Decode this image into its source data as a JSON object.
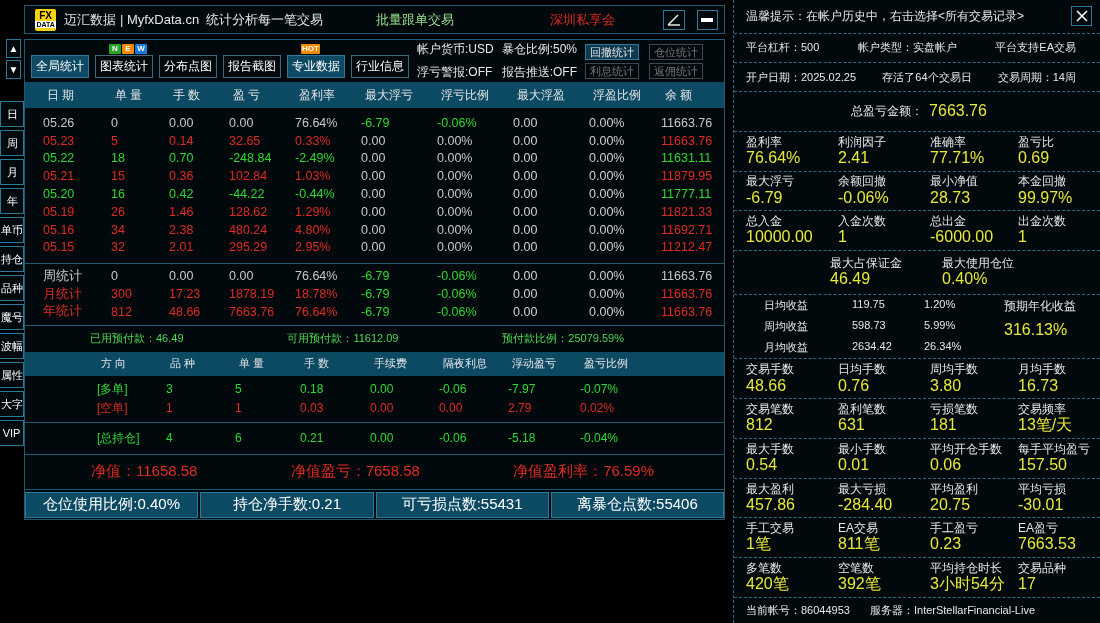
{
  "header": {
    "logo": [
      "FX",
      "DATA"
    ],
    "title": "迈汇数据 | MyfxData.cn  统计分析每一笔交易",
    "center": "批量跟单交易",
    "right": "深圳私享会"
  },
  "scroll": [
    "▲",
    "▼"
  ],
  "side_tabs": [
    {
      "label": "日",
      "kind": "boxed"
    },
    {
      "label": "周",
      "kind": "boxed"
    },
    {
      "label": "月",
      "kind": "boxed"
    },
    {
      "label": "年",
      "kind": "boxed"
    },
    {
      "label": "单币",
      "kind": "plain"
    },
    {
      "label": "持仓",
      "kind": "plain"
    },
    {
      "label": "品种",
      "kind": "plain"
    },
    {
      "label": "魔号",
      "kind": "plain"
    },
    {
      "label": "波幅",
      "kind": "plain"
    },
    {
      "label": "属性",
      "kind": "plain"
    },
    {
      "label": "大字",
      "kind": "plain"
    },
    {
      "label": "VIP",
      "kind": "plain"
    }
  ],
  "toolbar": [
    {
      "label": "全局统计",
      "selected": true
    },
    {
      "label": "图表统计",
      "selected": false,
      "badge": [
        {
          "letter": "N",
          "color": "#2aa52a"
        },
        {
          "letter": "E",
          "color": "#f08a00"
        },
        {
          "letter": "W",
          "color": "#1a7ae0"
        }
      ]
    },
    {
      "label": "分布点图",
      "selected": false
    },
    {
      "label": "报告截图",
      "selected": false
    },
    {
      "label": "专业数据",
      "selected": true,
      "badge": [
        {
          "letter": "HOT",
          "color": "#f08a00"
        }
      ]
    },
    {
      "label": "行业信息",
      "selected": false
    }
  ],
  "account_info": [
    [
      "帐户货币:USD",
      "暴仓比例:50%"
    ],
    [
      "浮亏警报:OFF",
      "报告推送:OFF"
    ]
  ],
  "small_buttons": [
    [
      {
        "label": "回撤统计",
        "disabled": false
      },
      {
        "label": "仓位统计",
        "disabled": true
      }
    ],
    [
      {
        "label": "利息统计",
        "disabled": true
      },
      {
        "label": "返佣统计",
        "disabled": true
      }
    ]
  ],
  "table": {
    "columns": [
      "日 期",
      "单 量",
      "手 数",
      "盈 亏",
      "盈利率",
      "最大浮亏",
      "浮亏比例",
      "最大浮盈",
      "浮盈比例",
      "余 额"
    ],
    "rows": [
      {
        "color": "#c8c8c8",
        "float": {
          "color": "#2fd82f"
        },
        "cells": [
          "05.26",
          "0",
          "0.00",
          "0.00",
          "76.64%",
          "-6.79",
          "-0.06%",
          "0.00",
          "0.00%",
          "11663.76"
        ]
      },
      {
        "color": "#e02a20",
        "float": {
          "color": "#c8c8c8"
        },
        "cells": [
          "05.23",
          "5",
          "0.14",
          "32.65",
          "0.33%",
          "0.00",
          "0.00%",
          "0.00",
          "0.00%",
          "11663.76"
        ]
      },
      {
        "color": "#2fd82f",
        "float": {
          "color": "#c8c8c8"
        },
        "cells": [
          "05.22",
          "18",
          "0.70",
          "-248.84",
          "-2.49%",
          "0.00",
          "0.00%",
          "0.00",
          "0.00%",
          "11631.11"
        ]
      },
      {
        "color": "#e02a20",
        "float": {
          "color": "#c8c8c8"
        },
        "cells": [
          "05.21",
          "15",
          "0.36",
          "102.84",
          "1.03%",
          "0.00",
          "0.00%",
          "0.00",
          "0.00%",
          "11879.95"
        ]
      },
      {
        "color": "#2fd82f",
        "float": {
          "color": "#c8c8c8"
        },
        "cells": [
          "05.20",
          "16",
          "0.42",
          "-44.22",
          "-0.44%",
          "0.00",
          "0.00%",
          "0.00",
          "0.00%",
          "11777.11"
        ]
      },
      {
        "color": "#e02a20",
        "float": {
          "color": "#c8c8c8"
        },
        "cells": [
          "05.19",
          "26",
          "1.46",
          "128.62",
          "1.29%",
          "0.00",
          "0.00%",
          "0.00",
          "0.00%",
          "11821.33"
        ]
      },
      {
        "color": "#e02a20",
        "float": {
          "color": "#c8c8c8"
        },
        "cells": [
          "05.16",
          "34",
          "2.38",
          "480.24",
          "4.80%",
          "0.00",
          "0.00%",
          "0.00",
          "0.00%",
          "11692.71"
        ]
      },
      {
        "color": "#e02a20",
        "float": {
          "color": "#c8c8c8"
        },
        "cells": [
          "05.15",
          "32",
          "2.01",
          "295.29",
          "2.95%",
          "0.00",
          "0.00%",
          "0.00",
          "0.00%",
          "11212.47"
        ]
      }
    ],
    "summary": [
      {
        "color": "#c8c8c8",
        "float": {
          "color": "#2fd82f"
        },
        "cells": [
          "周统计",
          "0",
          "0.00",
          "0.00",
          "76.64%",
          "-6.79",
          "-0.06%",
          "0.00",
          "0.00%",
          "11663.76"
        ]
      },
      {
        "color": "#e02a20",
        "float": {
          "color": "#2fd82f"
        },
        "cells": [
          "月统计",
          "300",
          "17.23",
          "1878.19",
          "18.78%",
          "-6.79",
          "-0.06%",
          "0.00",
          "0.00%",
          "11663.76"
        ]
      },
      {
        "color": "#e02a20",
        "float": {
          "color": "#2fd82f"
        },
        "cells": [
          "年统计",
          "812",
          "48.66",
          "7663.76",
          "76.64%",
          "-6.79",
          "-0.06%",
          "0.00",
          "0.00%",
          "11663.76"
        ]
      }
    ]
  },
  "prepaid": [
    "已用预付款：46.49",
    "可用预付款：11612.09",
    "预付款比例：25079.59%"
  ],
  "positions": {
    "columns": [
      "方 向",
      "品 种",
      "单 量",
      "手 数",
      "手续费",
      "隔夜利息",
      "浮动盈亏",
      "盈亏比例"
    ],
    "rows": [
      {
        "color": "#2fd82f",
        "cells": [
          "[多单]",
          "3",
          "5",
          "0.18",
          "0.00",
          "-0.06",
          "-7.97",
          "-0.07%"
        ]
      },
      {
        "color": "#e02a20",
        "cells": [
          "[空单]",
          "1",
          "1",
          "0.03",
          "0.00",
          "0.00",
          "2.79",
          "0.02%"
        ]
      }
    ],
    "total": {
      "color": "#2fd82f",
      "cells": [
        "[总持仓]",
        "4",
        "6",
        "0.21",
        "0.00",
        "-0.06",
        "-5.18",
        "-0.04%"
      ]
    }
  },
  "equity": [
    "净值：11658.58",
    "净值盈亏：7658.58",
    "净值盈利率：76.59%"
  ],
  "bottom_buttons": [
    "仓位使用比例:0.40%",
    "持仓净手数:0.21",
    "可亏损点数:55431",
    "离暴仓点数:55406"
  ],
  "panel": {
    "notice": "温馨提示：在帐户历史中，右击选择<所有交易记录>",
    "info_rows": [
      [
        "平台杠杆：500",
        "帐户类型：实盘帐户",
        "平台支持EA交易"
      ],
      [
        "开户日期：2025.02.25",
        "存活了64个交易日",
        "交易周期：14周"
      ]
    ],
    "total": {
      "label": "总盈亏金额：",
      "value": "7663.76"
    },
    "groups_a": [
      {
        "kind": "grid",
        "items": [
          {
            "label": "盈利率",
            "value": "76.64%"
          },
          {
            "label": "利润因子",
            "value": "2.41"
          },
          {
            "label": "准确率",
            "value": "77.71%"
          },
          {
            "label": "盈亏比",
            "value": "0.69"
          }
        ]
      },
      {
        "kind": "grid",
        "items": [
          {
            "label": "最大浮亏",
            "value": "-6.79"
          },
          {
            "label": "余额回撤",
            "value": "-0.06%"
          },
          {
            "label": "最小净值",
            "value": "28.73"
          },
          {
            "label": "本金回撤",
            "value": "99.97%"
          }
        ]
      },
      {
        "kind": "grid",
        "items": [
          {
            "label": "总入金",
            "value": "10000.00"
          },
          {
            "label": "入金次数",
            "value": "1"
          },
          {
            "label": "总出金",
            "value": "-6000.00"
          },
          {
            "label": "出金次数",
            "value": "1"
          }
        ]
      },
      {
        "kind": "pair",
        "items": [
          {
            "label": "最大占保证金",
            "value": "46.49"
          },
          {
            "label": "最大使用仓位",
            "value": "0.40%"
          }
        ]
      }
    ],
    "averages": {
      "rows": [
        [
          "日均收益",
          "119.75",
          "1.20%"
        ],
        [
          "周均收益",
          "598.73",
          "5.99%"
        ],
        [
          "月均收益",
          "2634.42",
          "26.34%"
        ]
      ],
      "annual": {
        "label": "预期年化收益",
        "value": "316.13%"
      }
    },
    "groups_b": [
      {
        "kind": "grid",
        "items": [
          {
            "label": "交易手数",
            "value": "48.66"
          },
          {
            "label": "日均手数",
            "value": "0.76"
          },
          {
            "label": "周均手数",
            "value": "3.80"
          },
          {
            "label": "月均手数",
            "value": "16.73"
          }
        ]
      },
      {
        "kind": "grid",
        "items": [
          {
            "label": "交易笔数",
            "value": "812"
          },
          {
            "label": "盈利笔数",
            "value": "631"
          },
          {
            "label": "亏损笔数",
            "value": "181"
          },
          {
            "label": "交易频率",
            "value": "13笔/天"
          }
        ]
      },
      {
        "kind": "grid",
        "items": [
          {
            "label": "最大手数",
            "value": "0.54"
          },
          {
            "label": "最小手数",
            "value": "0.01"
          },
          {
            "label": "平均开仓手数",
            "value": "0.06"
          },
          {
            "label": "每手平均盈亏",
            "value": "157.50"
          }
        ]
      },
      {
        "kind": "grid",
        "items": [
          {
            "label": "最大盈利",
            "value": "457.86"
          },
          {
            "label": "最大亏损",
            "value": "-284.40"
          },
          {
            "label": "平均盈利",
            "value": "20.75"
          },
          {
            "label": "平均亏损",
            "value": "-30.01"
          }
        ]
      },
      {
        "kind": "grid",
        "items": [
          {
            "label": "手工交易",
            "value": "1笔"
          },
          {
            "label": "EA交易",
            "value": "811笔"
          },
          {
            "label": "手工盈亏",
            "value": "0.23"
          },
          {
            "label": "EA盈亏",
            "value": "7663.53"
          }
        ]
      },
      {
        "kind": "grid",
        "items": [
          {
            "label": "多笔数",
            "value": "420笔"
          },
          {
            "label": "空笔数",
            "value": "392笔"
          },
          {
            "label": "平均持仓时长",
            "value": "3小时54分"
          },
          {
            "label": "交易品种",
            "value": "17"
          }
        ]
      }
    ],
    "footer": [
      "当前帐号：86044953",
      "服务器：InterStellarFinancial-Live"
    ]
  }
}
